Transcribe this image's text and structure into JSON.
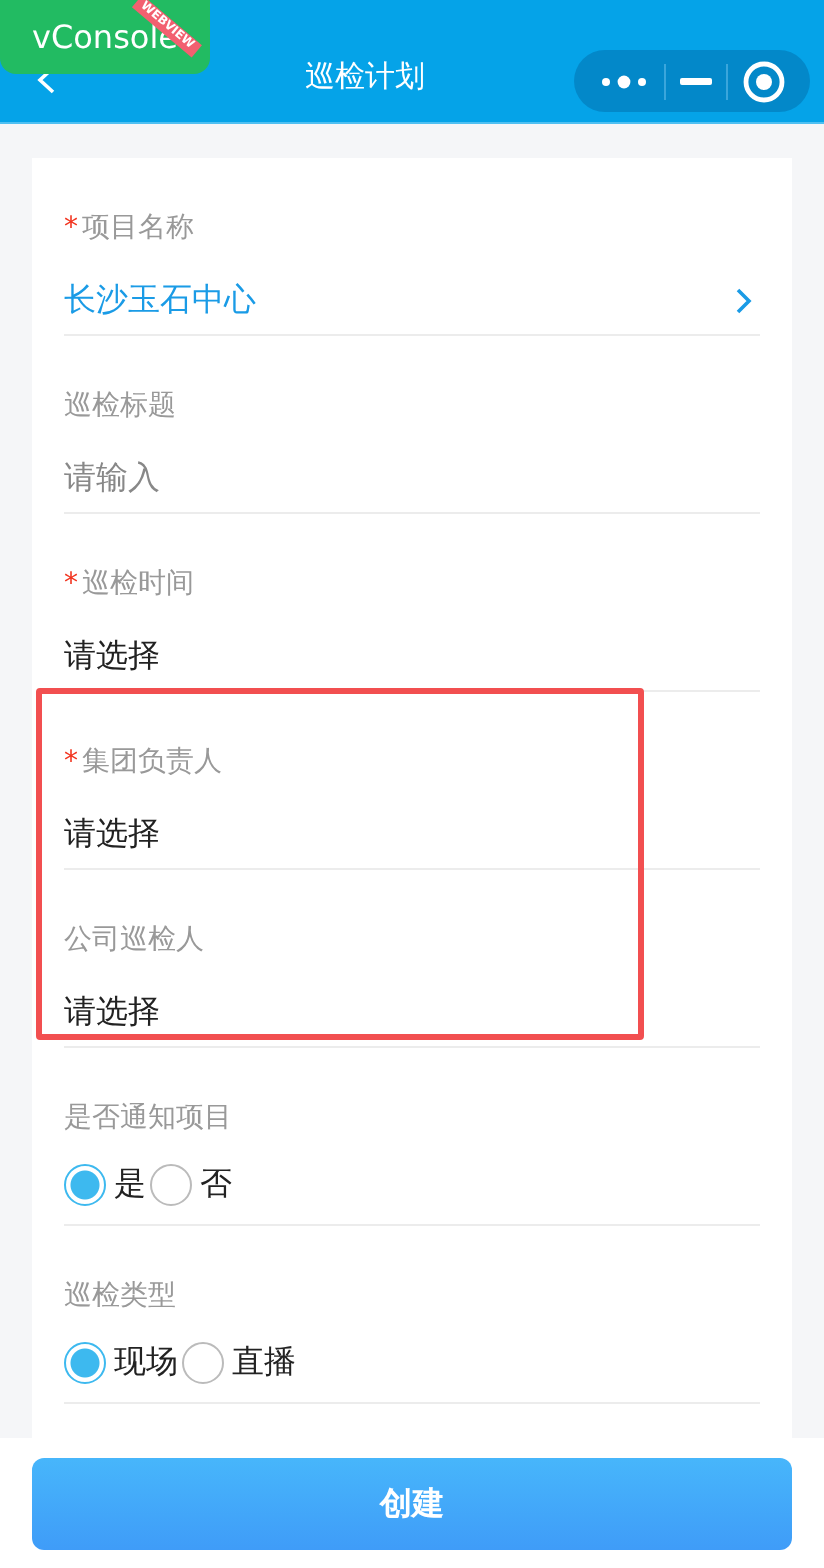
{
  "debug_badge": {
    "label": "vConsole",
    "ribbon": "WEBVIEW"
  },
  "nav": {
    "title": "巡检计划"
  },
  "fields": [
    {
      "kind": "select",
      "label": "项目名称",
      "marker": "*",
      "value": "长沙玉石中心",
      "filled": true,
      "highlighted": false
    },
    {
      "kind": "input",
      "label": "巡检标题",
      "placeholder": "请输入",
      "highlighted": false
    },
    {
      "kind": "select",
      "label": "巡检时间",
      "marker": "*",
      "value": "请选择",
      "filled": false,
      "highlighted": false
    },
    {
      "kind": "select",
      "label": "集团负责人",
      "marker": "*",
      "value": "请选择",
      "filled": false,
      "highlighted": true
    },
    {
      "kind": "select",
      "label": "公司巡检人",
      "value": "请选择",
      "filled": false,
      "highlighted": true
    },
    {
      "kind": "radio",
      "label": "是否通知项目",
      "highlighted": false,
      "options": [
        {
          "label": "是",
          "selected": true
        },
        {
          "label": "否",
          "selected": false
        }
      ]
    },
    {
      "kind": "radio",
      "label": "巡检类型",
      "highlighted": false,
      "options": [
        {
          "label": "现场",
          "selected": true
        },
        {
          "label": "直播",
          "selected": false
        }
      ]
    }
  ],
  "submit": {
    "label": "创建"
  }
}
